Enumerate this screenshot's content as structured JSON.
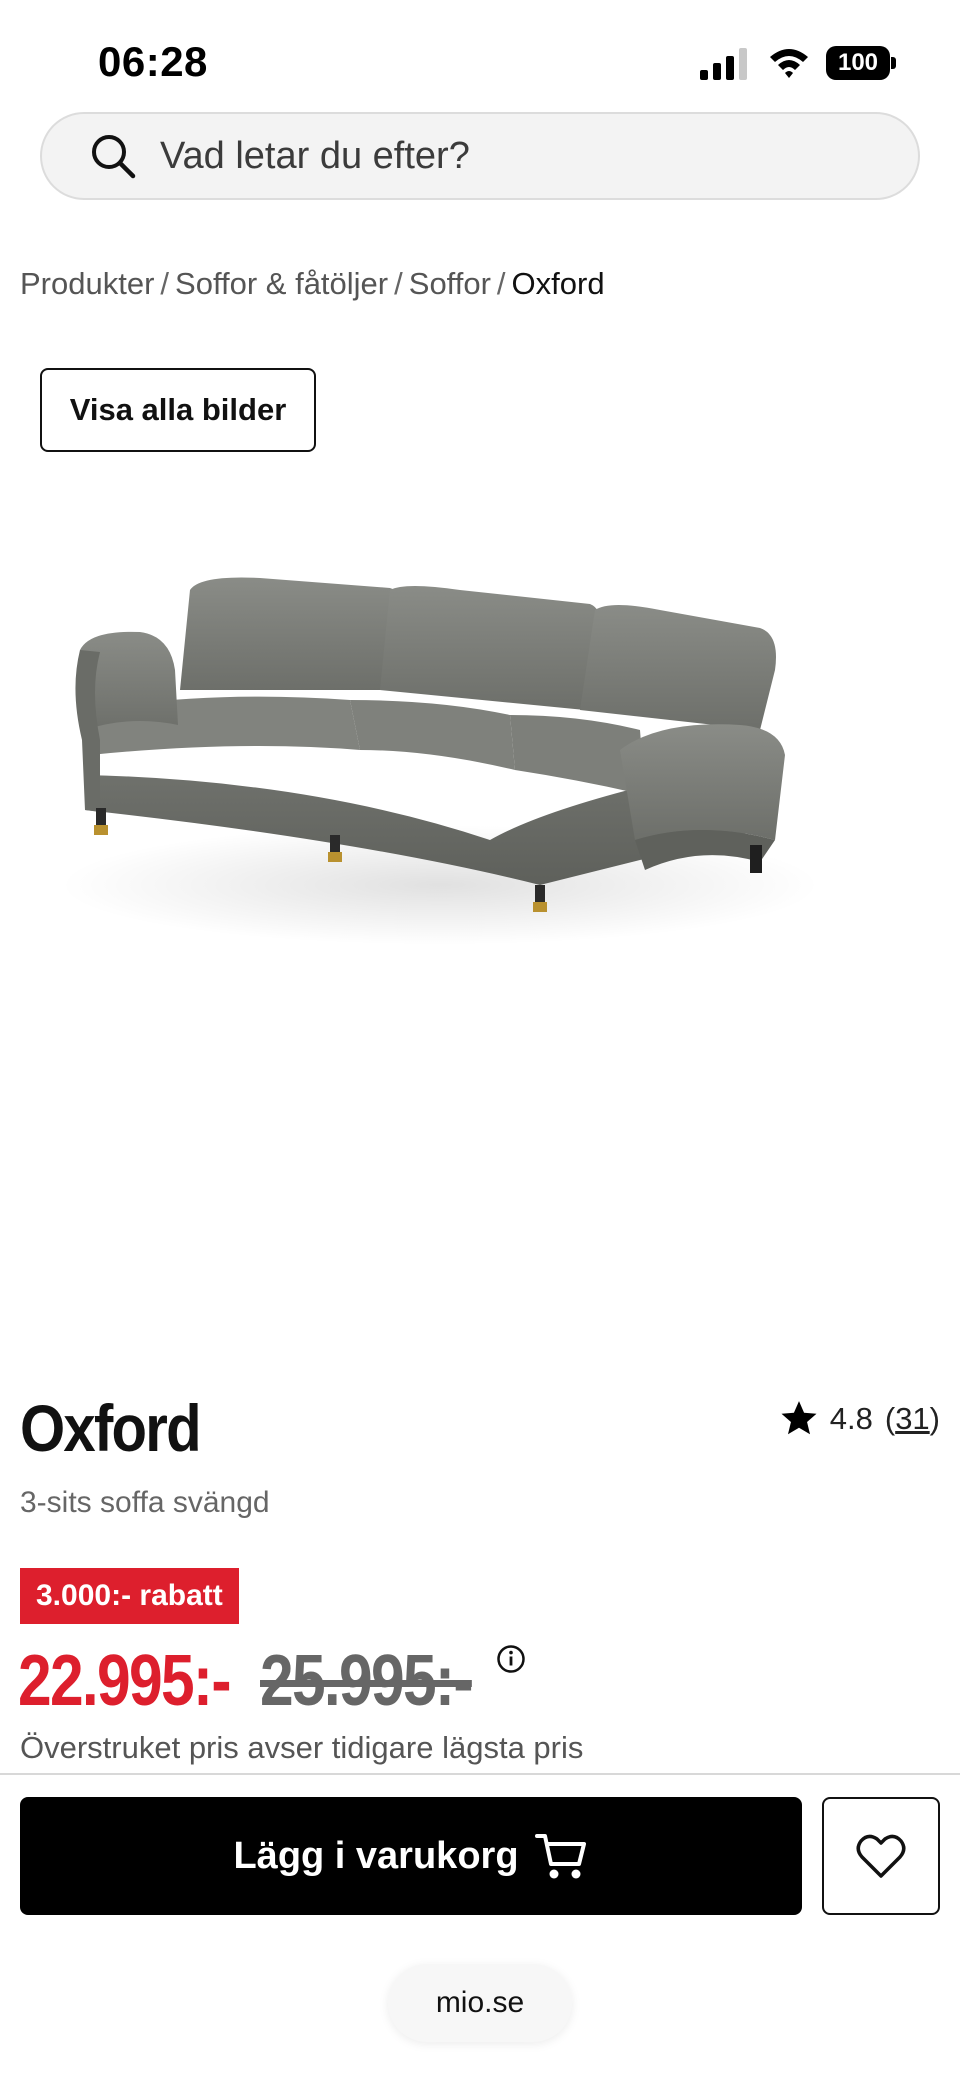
{
  "status_bar": {
    "time": "06:28",
    "battery": "100",
    "icons": [
      "signal-icon",
      "wifi-icon",
      "battery-icon"
    ]
  },
  "search": {
    "placeholder": "Vad letar du efter?",
    "icon": "search-icon"
  },
  "breadcrumb": {
    "items": [
      "Produkter",
      "Soffor & fåtöljer",
      "Soffor"
    ],
    "separator": "/",
    "current": "Oxford"
  },
  "gallery": {
    "show_all_label": "Visa alla bilder"
  },
  "product": {
    "title": "Oxford",
    "subtitle": "3-sits soffa svängd",
    "rating": "4.8",
    "review_count": "31",
    "rating_open": "(",
    "rating_close": ")",
    "discount_badge": "3.000:- rabatt",
    "price_current": "22.995:-",
    "price_old": "25.995:-",
    "price_note": "Överstruket pris avser tidigare lägsta pris",
    "colors": {
      "sale_red": "#dd1f2d",
      "sofa_fabric": "#7d7f7a"
    }
  },
  "actions": {
    "add_to_cart_label": "Lägg i varukorg",
    "cart_icon": "cart-icon",
    "wishlist_icon": "heart-icon"
  },
  "browser": {
    "url": "mio.se"
  }
}
